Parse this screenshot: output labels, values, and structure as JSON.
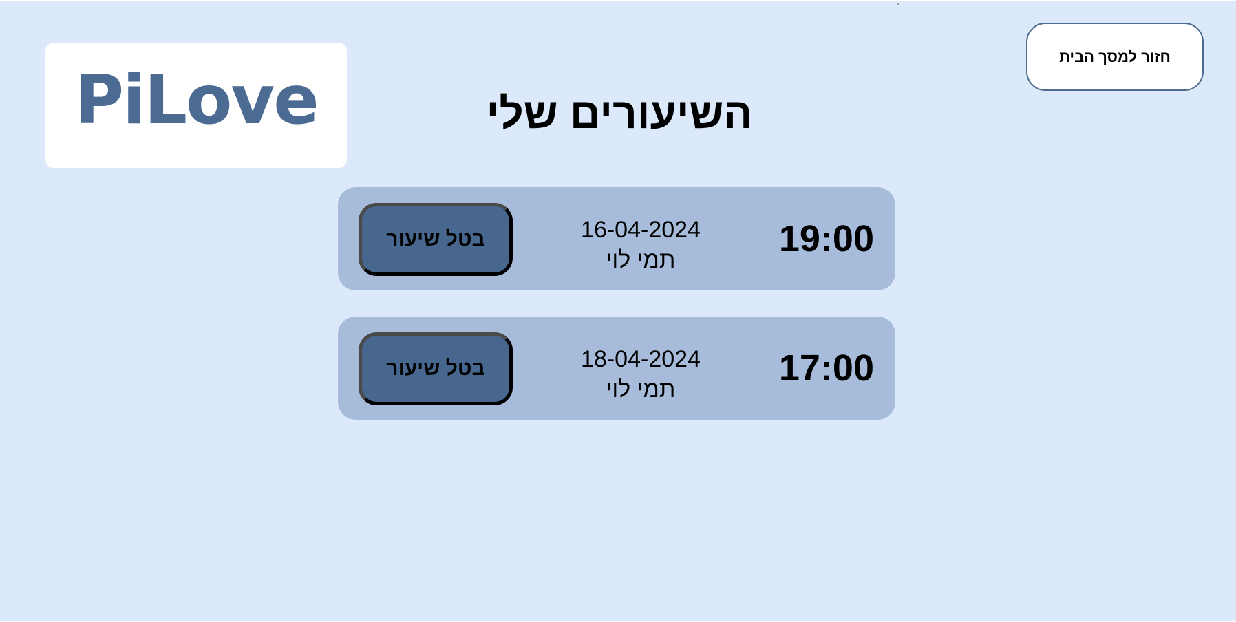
{
  "app": {
    "logo_text": "PiLove",
    "background_color": "#dbe9fb",
    "accent_color": "#47678f",
    "card_color": "#a7bcda"
  },
  "header": {
    "home_button_label": "חזור למסך הבית",
    "page_title": "השיעורים שלי",
    "stray_mark": "`"
  },
  "lessons": [
    {
      "time": "19:00",
      "date": "16-04-2024",
      "teacher": "תמי לוי",
      "cancel_label": "בטל שיעור"
    },
    {
      "time": "17:00",
      "date": "18-04-2024",
      "teacher": "תמי לוי",
      "cancel_label": "בטל שיעור"
    }
  ]
}
